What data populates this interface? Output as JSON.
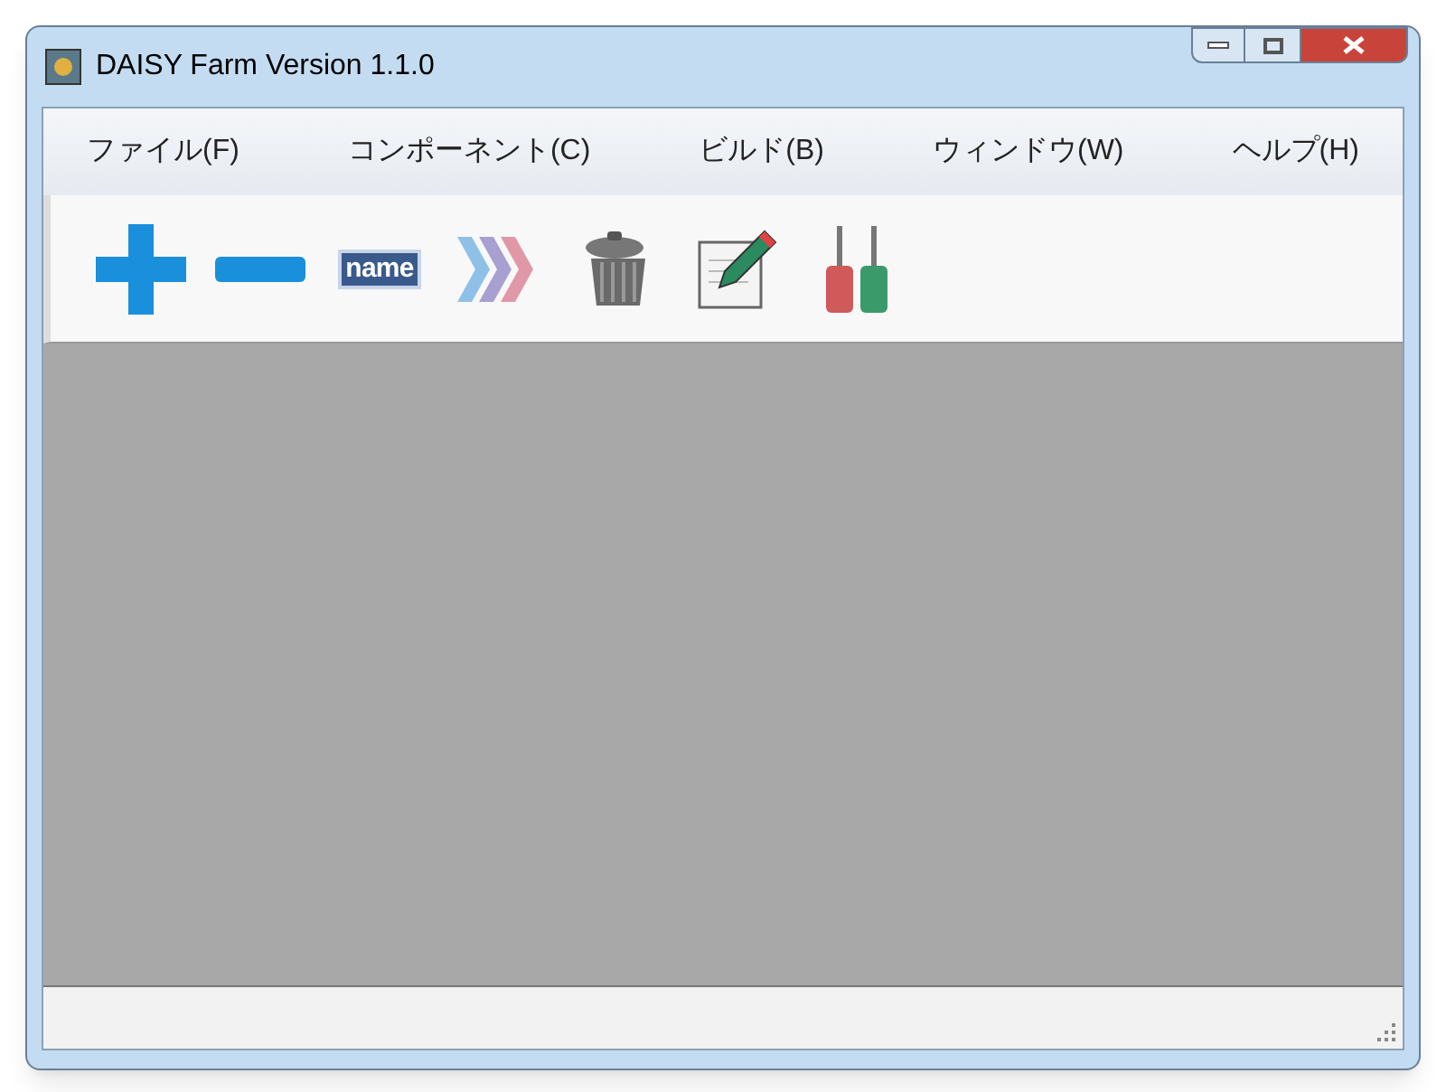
{
  "window": {
    "title": "DAISY Farm Version 1.1.0"
  },
  "menu": [
    {
      "label": "ファイル(F)"
    },
    {
      "label": "コンポーネント(C)"
    },
    {
      "label": "ビルド(B)"
    },
    {
      "label": "ウィンドウ(W)"
    },
    {
      "label": "ヘルプ(H)"
    }
  ],
  "toolbar": [
    {
      "kind": "plus"
    },
    {
      "kind": "minus"
    },
    {
      "kind": "name",
      "text": "name"
    },
    {
      "kind": "chevrons"
    },
    {
      "kind": "trash"
    },
    {
      "kind": "edit"
    },
    {
      "kind": "tools"
    }
  ]
}
